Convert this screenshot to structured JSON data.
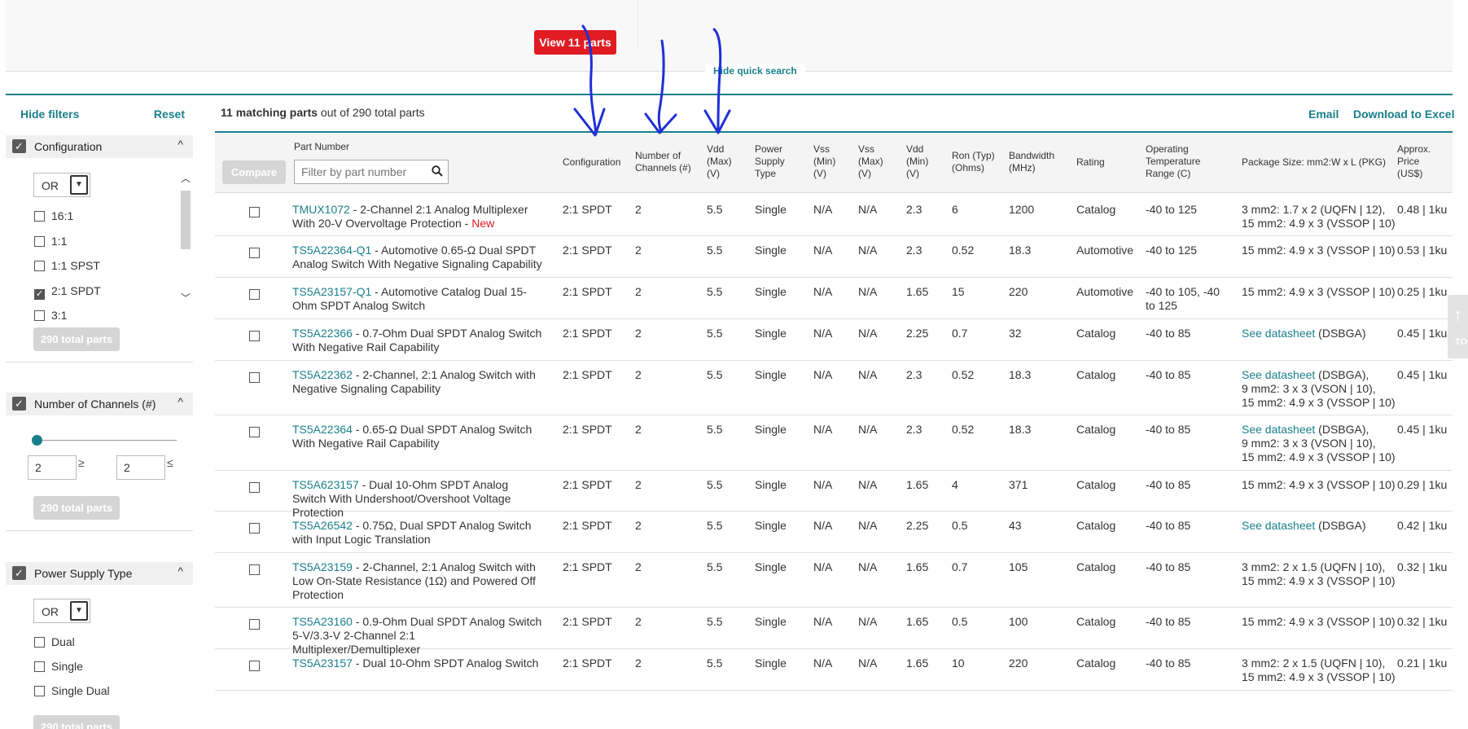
{
  "quick_search": {
    "view_button": "View 11 parts",
    "hide_label": "Hide quick search"
  },
  "sidebar": {
    "hide_filters": "Hide filters",
    "reset": "Reset",
    "configuration": {
      "title": "Configuration",
      "operator": "OR",
      "options": [
        {
          "label": "16:1",
          "checked": false
        },
        {
          "label": "1:1",
          "checked": false
        },
        {
          "label": "1:1 SPST",
          "checked": false
        },
        {
          "label": "2:1 SPDT",
          "checked": true
        },
        {
          "label": "3:1",
          "checked": false
        }
      ],
      "total_button": "290 total parts"
    },
    "channels": {
      "title": "Number of Channels (#)",
      "min_value": "2",
      "max_value": "2",
      "min_rel": "≥",
      "max_rel": "≤",
      "total_button": "290 total parts"
    },
    "power": {
      "title": "Power Supply Type",
      "operator": "OR",
      "options": [
        {
          "label": "Dual",
          "checked": false
        },
        {
          "label": "Single",
          "checked": false
        },
        {
          "label": "Single Dual",
          "checked": false
        }
      ],
      "total_button": "290 total parts"
    }
  },
  "results": {
    "count_bold": "11 matching parts",
    "count_rest": " out of 290 total parts",
    "email": "Email",
    "download": "Download to Excel",
    "compare": "Compare",
    "part_number_header": "Part Number",
    "filter_placeholder": "Filter by part number",
    "headers": {
      "configuration": "Configuration",
      "channels": "Number of Channels (#)",
      "vdd_max": "Vdd (Max) (V)",
      "power": "Power Supply Type",
      "vss_min": "Vss (Min) (V)",
      "vss_max": "Vss (Max) (V)",
      "vdd_min": "Vdd (Min) (V)",
      "ron": "Ron (Typ) (Ohms)",
      "bandwidth": "Bandwidth (MHz)",
      "rating": "Rating",
      "temp": "Operating Temperature Range (C)",
      "package": "Package Size: mm2:W x L (PKG)",
      "price": "Approx. Price (US$)"
    },
    "rows": [
      {
        "part": "TMUX1072",
        "desc": " - 2-Channel 2:1 Analog Multiplexer With 20-V Overvoltage Protection - ",
        "new": "New",
        "config": "2:1 SPDT",
        "ch": "2",
        "vddmax": "5.5",
        "power": "Single",
        "vssmin": "N/A",
        "vssmax": "N/A",
        "vddmin": "2.3",
        "ron": "6",
        "bw": "1200",
        "rating": "Catalog",
        "temp": "-40 to 125",
        "pkg_link": "",
        "pkg": "3 mm2: 1.7 x 2 (UQFN | 12),\n15 mm2: 4.9 x 3 (VSSOP | 10)",
        "price": "0.48 | 1ku"
      },
      {
        "part": "TS5A22364-Q1",
        "desc": " - Automotive 0.65-Ω Dual SPDT Analog Switch With Negative Signaling Capability",
        "new": "",
        "config": "2:1 SPDT",
        "ch": "2",
        "vddmax": "5.5",
        "power": "Single",
        "vssmin": "N/A",
        "vssmax": "N/A",
        "vddmin": "2.3",
        "ron": "0.52",
        "bw": "18.3",
        "rating": "Automotive",
        "temp": "-40 to 125",
        "pkg_link": "",
        "pkg": "15 mm2: 4.9 x 3 (VSSOP | 10)",
        "price": "0.53 | 1ku"
      },
      {
        "part": "TS5A23157-Q1",
        "desc": " - Automotive Catalog Dual 15-Ohm SPDT Analog Switch",
        "new": "",
        "config": "2:1 SPDT",
        "ch": "2",
        "vddmax": "5.5",
        "power": "Single",
        "vssmin": "N/A",
        "vssmax": "N/A",
        "vddmin": "1.65",
        "ron": "15",
        "bw": "220",
        "rating": "Automotive",
        "temp": "-40 to 105, -40 to 125",
        "pkg_link": "",
        "pkg": "15 mm2: 4.9 x 3 (VSSOP | 10)",
        "price": "0.25 | 1ku"
      },
      {
        "part": "TS5A22366",
        "desc": " - 0.7-Ohm Dual SPDT Analog Switch With Negative Rail Capability",
        "new": "",
        "config": "2:1 SPDT",
        "ch": "2",
        "vddmax": "5.5",
        "power": "Single",
        "vssmin": "N/A",
        "vssmax": "N/A",
        "vddmin": "2.25",
        "ron": "0.7",
        "bw": "32",
        "rating": "Catalog",
        "temp": "-40 to 85",
        "pkg_link": "See datasheet",
        "pkg": " (DSBGA)",
        "price": "0.45 | 1ku"
      },
      {
        "part": "TS5A22362",
        "desc": " - 2-Channel, 2:1 Analog Switch with Negative Signaling Capability",
        "new": "",
        "config": "2:1 SPDT",
        "ch": "2",
        "vddmax": "5.5",
        "power": "Single",
        "vssmin": "N/A",
        "vssmax": "N/A",
        "vddmin": "2.3",
        "ron": "0.52",
        "bw": "18.3",
        "rating": "Catalog",
        "temp": "-40 to 85",
        "pkg_link": "See datasheet",
        "pkg": " (DSBGA),\n9 mm2: 3 x 3 (VSON | 10),\n15 mm2: 4.9 x 3 (VSSOP | 10)",
        "price": "0.45 | 1ku"
      },
      {
        "part": "TS5A22364",
        "desc": " - 0.65-Ω Dual SPDT Analog Switch With Negative Rail Capability",
        "new": "",
        "config": "2:1 SPDT",
        "ch": "2",
        "vddmax": "5.5",
        "power": "Single",
        "vssmin": "N/A",
        "vssmax": "N/A",
        "vddmin": "2.3",
        "ron": "0.52",
        "bw": "18.3",
        "rating": "Catalog",
        "temp": "-40 to 85",
        "pkg_link": "See datasheet",
        "pkg": " (DSBGA),\n9 mm2: 3 x 3 (VSON | 10),\n15 mm2: 4.9 x 3 (VSSOP | 10)",
        "price": "0.45 | 1ku"
      },
      {
        "part": "TS5A623157",
        "desc": " - Dual 10-Ohm SPDT Analog Switch With Undershoot/Overshoot Voltage Protection",
        "new": "",
        "config": "2:1 SPDT",
        "ch": "2",
        "vddmax": "5.5",
        "power": "Single",
        "vssmin": "N/A",
        "vssmax": "N/A",
        "vddmin": "1.65",
        "ron": "4",
        "bw": "371",
        "rating": "Catalog",
        "temp": "-40 to 85",
        "pkg_link": "",
        "pkg": "15 mm2: 4.9 x 3 (VSSOP | 10)",
        "price": "0.29 | 1ku"
      },
      {
        "part": "TS5A26542",
        "desc": " - 0.75Ω, Dual SPDT Analog Switch with Input Logic Translation",
        "new": "",
        "config": "2:1 SPDT",
        "ch": "2",
        "vddmax": "5.5",
        "power": "Single",
        "vssmin": "N/A",
        "vssmax": "N/A",
        "vddmin": "2.25",
        "ron": "0.5",
        "bw": "43",
        "rating": "Catalog",
        "temp": "-40 to 85",
        "pkg_link": "See datasheet",
        "pkg": " (DSBGA)",
        "price": "0.42 | 1ku"
      },
      {
        "part": "TS5A23159",
        "desc": " - 2-Channel, 2:1 Analog Switch with Low On-State Resistance (1Ω) and Powered Off Protection",
        "new": "",
        "config": "2:1 SPDT",
        "ch": "2",
        "vddmax": "5.5",
        "power": "Single",
        "vssmin": "N/A",
        "vssmax": "N/A",
        "vddmin": "1.65",
        "ron": "0.7",
        "bw": "105",
        "rating": "Catalog",
        "temp": "-40 to 85",
        "pkg_link": "",
        "pkg": "3 mm2: 2 x 1.5 (UQFN | 10),\n15 mm2: 4.9 x 3 (VSSOP | 10)",
        "price": "0.32 | 1ku"
      },
      {
        "part": "TS5A23160",
        "desc": " - 0.9-Ohm Dual SPDT Analog Switch 5-V/3.3-V 2-Channel 2:1 Multiplexer/Demultiplexer",
        "new": "",
        "config": "2:1 SPDT",
        "ch": "2",
        "vddmax": "5.5",
        "power": "Single",
        "vssmin": "N/A",
        "vssmax": "N/A",
        "vddmin": "1.65",
        "ron": "0.5",
        "bw": "100",
        "rating": "Catalog",
        "temp": "-40 to 85",
        "pkg_link": "",
        "pkg": "15 mm2: 4.9 x 3 (VSSOP | 10)",
        "price": "0.32 | 1ku"
      },
      {
        "part": "TS5A23157",
        "desc": " - Dual 10-Ohm SPDT Analog Switch",
        "new": "",
        "config": "2:1 SPDT",
        "ch": "2",
        "vddmax": "5.5",
        "power": "Single",
        "vssmin": "N/A",
        "vssmax": "N/A",
        "vddmin": "1.65",
        "ron": "10",
        "bw": "220",
        "rating": "Catalog",
        "temp": "-40 to 85",
        "pkg_link": "",
        "pkg": "3 mm2: 2 x 1.5 (UQFN | 10),\n15 mm2: 4.9 x 3 (VSSOP | 10)",
        "price": "0.21 | 1ku"
      }
    ]
  },
  "to_top": {
    "label": "TO"
  },
  "colors": {
    "accent": "#1a7f8a",
    "primary_button": "#e01b22",
    "annotation_ink": "#1f2fd6"
  }
}
